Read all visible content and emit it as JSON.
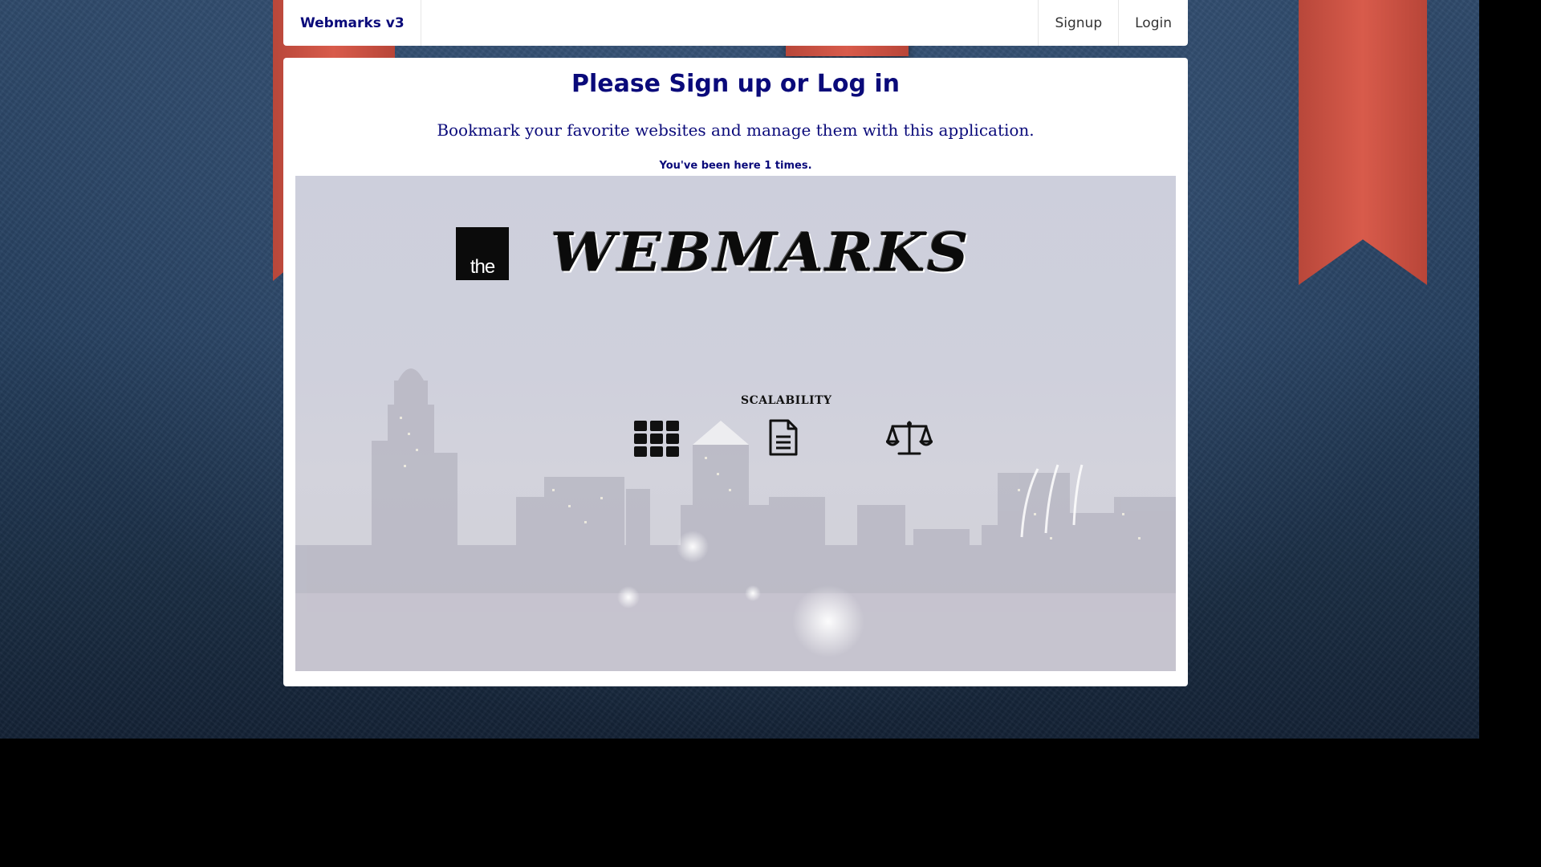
{
  "navbar": {
    "brand": "Webmarks v3",
    "links": [
      {
        "label": "Signup"
      },
      {
        "label": "Login"
      }
    ]
  },
  "main": {
    "title": "Please Sign up or Log in",
    "subtitle": "Bookmark your favorite websites and manage them with this application.",
    "visit_counter": "You've been here 1 times."
  },
  "hero": {
    "logo_badge_text": "the",
    "wordmark": "WEBMARKS",
    "feature_label": "SCALABILITY",
    "icons": [
      "grid-icon",
      "document-icon",
      "balance-scale-icon"
    ]
  },
  "colors": {
    "brand_navy": "#0a0a7a",
    "ribbon_red": "#d85b4b",
    "background_blue": "#2f4a6b"
  }
}
